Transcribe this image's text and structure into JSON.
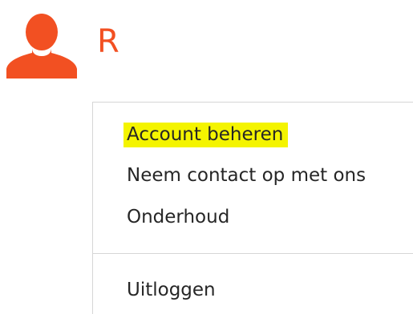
{
  "user": {
    "initial": "R",
    "avatar_icon": "person-silhouette-icon",
    "accent_color": "#F25022"
  },
  "menu": {
    "items": [
      {
        "label": "Account beheren",
        "highlighted": true
      },
      {
        "label": "Neem contact op met ons"
      },
      {
        "label": "Onderhoud"
      }
    ],
    "logout_label": "Uitloggen",
    "highlight_color": "#F4F400"
  }
}
